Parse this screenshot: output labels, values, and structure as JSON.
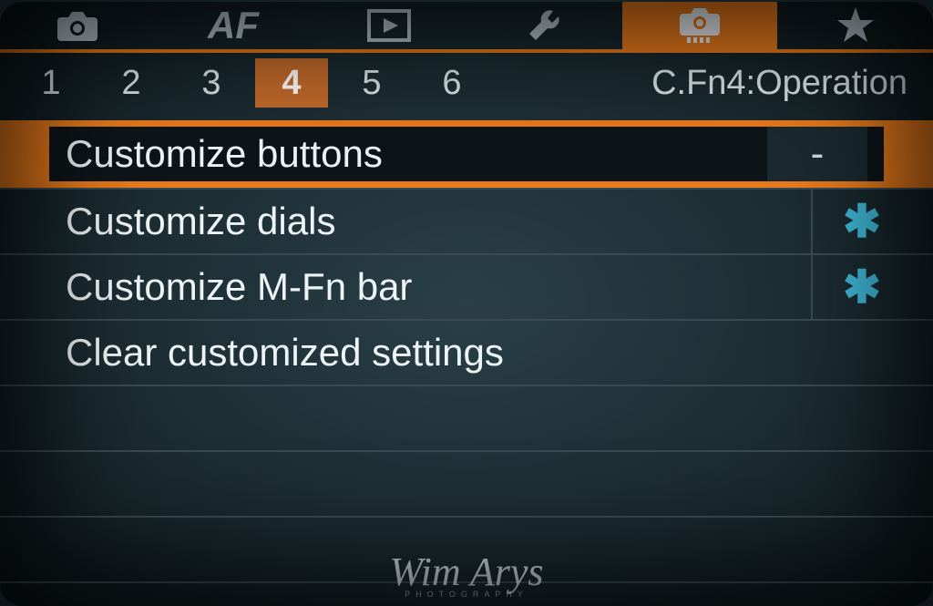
{
  "top_tabs": {
    "af_label": "AF"
  },
  "sub_tabs": {
    "items": [
      {
        "label": "1"
      },
      {
        "label": "2"
      },
      {
        "label": "3"
      },
      {
        "label": "4"
      },
      {
        "label": "5"
      },
      {
        "label": "6"
      }
    ],
    "active_index": 3,
    "title": "C.Fn4:Operation"
  },
  "menu": {
    "items": [
      {
        "label": "Customize buttons",
        "value": "-",
        "selected": true,
        "value_style": "dash"
      },
      {
        "label": "Customize dials",
        "value": "✱",
        "selected": false,
        "value_style": "star"
      },
      {
        "label": "Customize M-Fn bar",
        "value": "✱",
        "selected": false,
        "value_style": "star"
      },
      {
        "label": "Clear customized settings",
        "value": "",
        "selected": false,
        "value_style": ""
      }
    ]
  },
  "watermark": {
    "main": "Wim Arys",
    "sub": "PHOTOGRAPHY"
  }
}
